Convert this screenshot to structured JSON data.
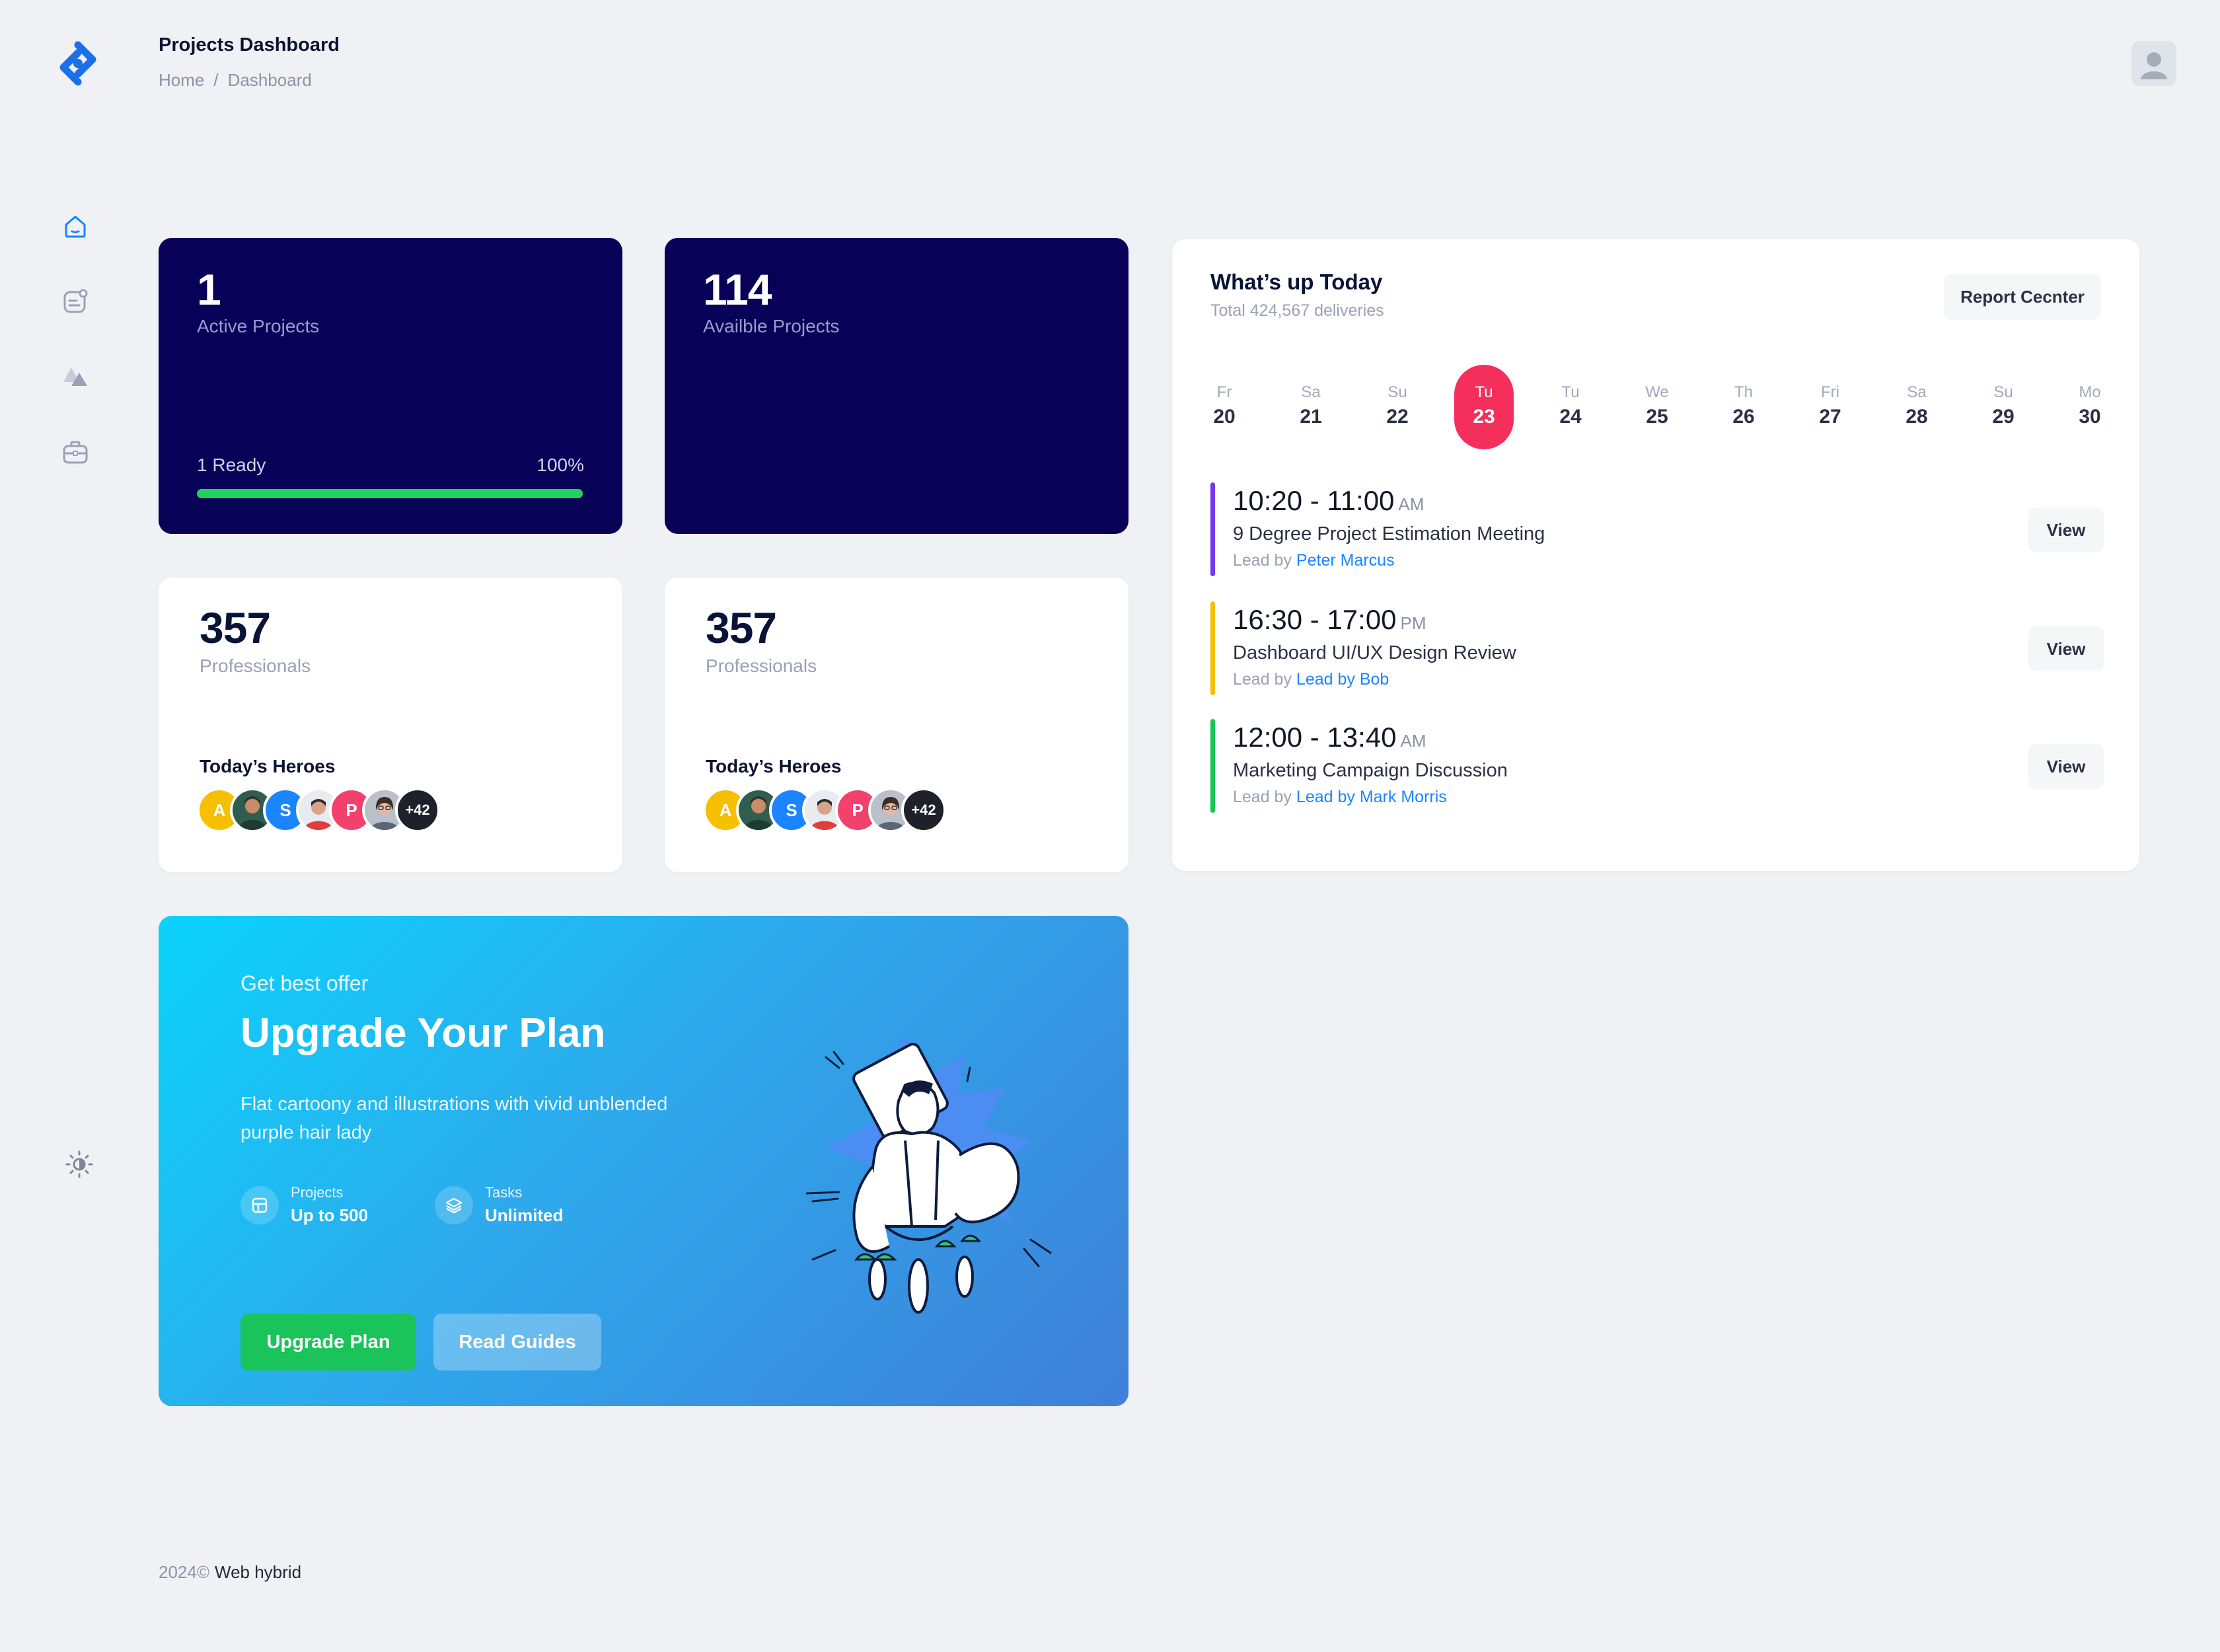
{
  "header": {
    "title": "Projects Dashboard",
    "breadcrumb": [
      "Home",
      "/",
      "Dashboard"
    ]
  },
  "sidebar": {
    "items": [
      {
        "icon": "home-icon",
        "active": true
      },
      {
        "icon": "chat-icon",
        "active": false
      },
      {
        "icon": "shapes-icon",
        "active": false
      },
      {
        "icon": "briefcase-icon",
        "active": false
      }
    ],
    "bottom_icon": "theme-toggle-icon"
  },
  "cards": {
    "active_projects": {
      "value": "1",
      "label": "Active Projects",
      "ready_label": "1 Ready",
      "percent_label": "100%",
      "progress": 1.0
    },
    "available_projects": {
      "value": "114",
      "label": "Availble Projects"
    },
    "professionals_1": {
      "value": "357",
      "label": "Professionals",
      "heroes_title": "Today’s Heroes",
      "more": "+42"
    },
    "professionals_2": {
      "value": "357",
      "label": "Professionals",
      "heroes_title": "Today’s Heroes",
      "more": "+42"
    }
  },
  "heroes": [
    {
      "initial": "A",
      "color": "#f6c000"
    },
    {
      "initial": "",
      "color": "#2f5d50"
    },
    {
      "initial": "S",
      "color": "#1b84ff"
    },
    {
      "initial": "",
      "color": "#b9c0ca"
    },
    {
      "initial": "P",
      "color": "#f1416c"
    },
    {
      "initial": "",
      "color": "#8c98a8"
    }
  ],
  "upgrade": {
    "kicker": "Get best offer",
    "title": "Upgrade Your Plan",
    "description_line1": "Flat cartoony and illustrations with vivid unblended",
    "description_line2": "purple hair lady",
    "features": [
      {
        "label": "Projects",
        "value": "Up to 500",
        "icon": "grid-icon"
      },
      {
        "label": "Tasks",
        "value": "Unlimited",
        "icon": "layers-icon"
      }
    ],
    "primary_button": "Upgrade Plan",
    "secondary_button": "Read Guides"
  },
  "schedule": {
    "title": "What’s up Today",
    "subtitle": "Total 424,567 deliveries",
    "report_button": "Report Cecnter",
    "days": [
      {
        "name": "Fr",
        "date": "20"
      },
      {
        "name": "Sa",
        "date": "21"
      },
      {
        "name": "Su",
        "date": "22"
      },
      {
        "name": "Tu",
        "date": "23",
        "active": true
      },
      {
        "name": "Tu",
        "date": "24"
      },
      {
        "name": "We",
        "date": "25"
      },
      {
        "name": "Th",
        "date": "26"
      },
      {
        "name": "Fri",
        "date": "27"
      },
      {
        "name": "Sa",
        "date": "28"
      },
      {
        "name": "Su",
        "date": "29"
      },
      {
        "name": "Mo",
        "date": "30"
      }
    ],
    "events": [
      {
        "time": "10:20 - 11:00",
        "ampm": "AM",
        "title": "9 Degree Project Estimation Meeting",
        "lead_prefix": "Lead by",
        "lead": "Peter Marcus",
        "color": "#7239ea",
        "button": "View"
      },
      {
        "time": "16:30 - 17:00",
        "ampm": "PM",
        "title": "Dashboard UI/UX Design Review",
        "lead_prefix": "Lead by",
        "lead": "Lead by Bob",
        "color": "#f6c000",
        "button": "View"
      },
      {
        "time": "12:00 - 13:40",
        "ampm": "AM",
        "title": "Marketing Campaign Discussion",
        "lead_prefix": "Lead by",
        "lead": "Lead by Mark Morris",
        "color": "#17c653",
        "button": "View"
      }
    ]
  },
  "footer": {
    "year": "2024©",
    "brand": "Web hybrid"
  }
}
